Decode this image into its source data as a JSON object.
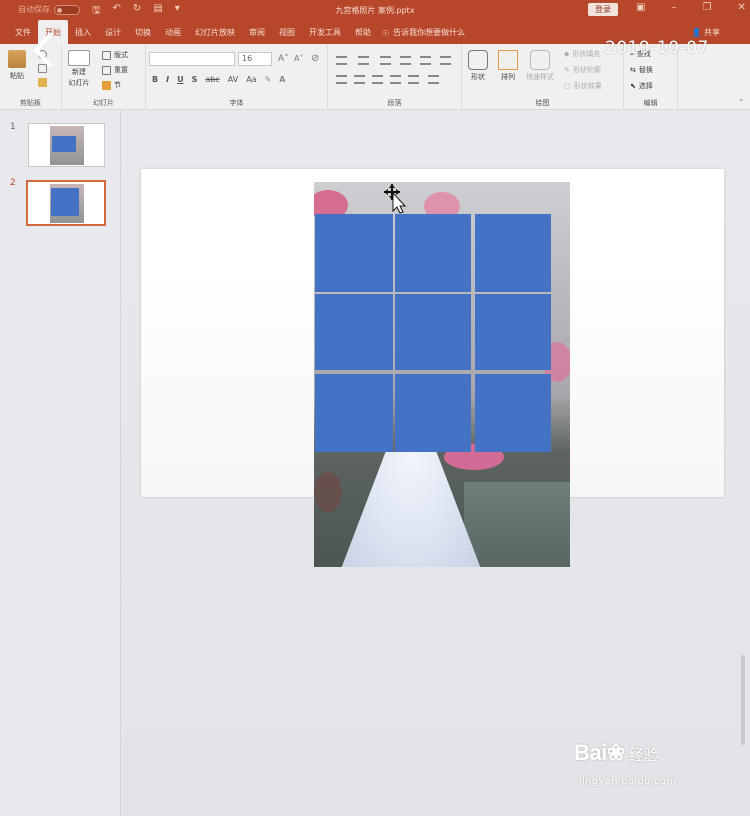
{
  "titlebar": {
    "autosave_label": "自动保存",
    "autosave_state": "关",
    "document_title": "九宫格照片 案例.pptx",
    "login_label": "登录"
  },
  "menu": {
    "tabs": [
      "文件",
      "开始",
      "插入",
      "设计",
      "切换",
      "动画",
      "幻灯片放映",
      "审阅",
      "视图",
      "开发工具",
      "帮助"
    ],
    "active_tab": "开始",
    "tell_me": "告诉我你想要做什么",
    "share": "共享"
  },
  "overlay": {
    "date_stamp": "2019-10-07"
  },
  "ribbon": {
    "clipboard": {
      "paste": "粘贴",
      "label": "剪贴板"
    },
    "slides": {
      "new_slide": "新建",
      "new_slide_line2": "幻灯片",
      "layout": "版式",
      "reset": "重置",
      "section": "节",
      "label": "幻灯片"
    },
    "font": {
      "size": "16",
      "label": "字体",
      "bold": "B",
      "italic": "I",
      "underline": "U",
      "shadow": "S",
      "strike": "abc",
      "spacing": "AV",
      "case": "Aa"
    },
    "paragraph": {
      "label": "段落"
    },
    "drawing": {
      "shapes": "形状",
      "arrange": "排列",
      "quick_styles": "快速样式",
      "fill": "形状填充",
      "outline": "形状轮廓",
      "effects": "形状效果",
      "label": "绘图"
    },
    "editing": {
      "find": "查找",
      "replace": "替换",
      "select": "选择",
      "label": "编辑"
    }
  },
  "thumbnails": [
    {
      "number": "1",
      "selected": false
    },
    {
      "number": "2",
      "selected": true
    }
  ],
  "slide": {
    "tile_color": "#4472c4",
    "grid_rows": 3,
    "grid_cols": 3
  },
  "watermark": {
    "brand": "Bai",
    "brand_suffix": "百",
    "sub": "经验",
    "url": "jingyan.baidu.com"
  },
  "colors": {
    "accent": "#b7472a",
    "ribbon_bg": "#f1f0f0"
  }
}
